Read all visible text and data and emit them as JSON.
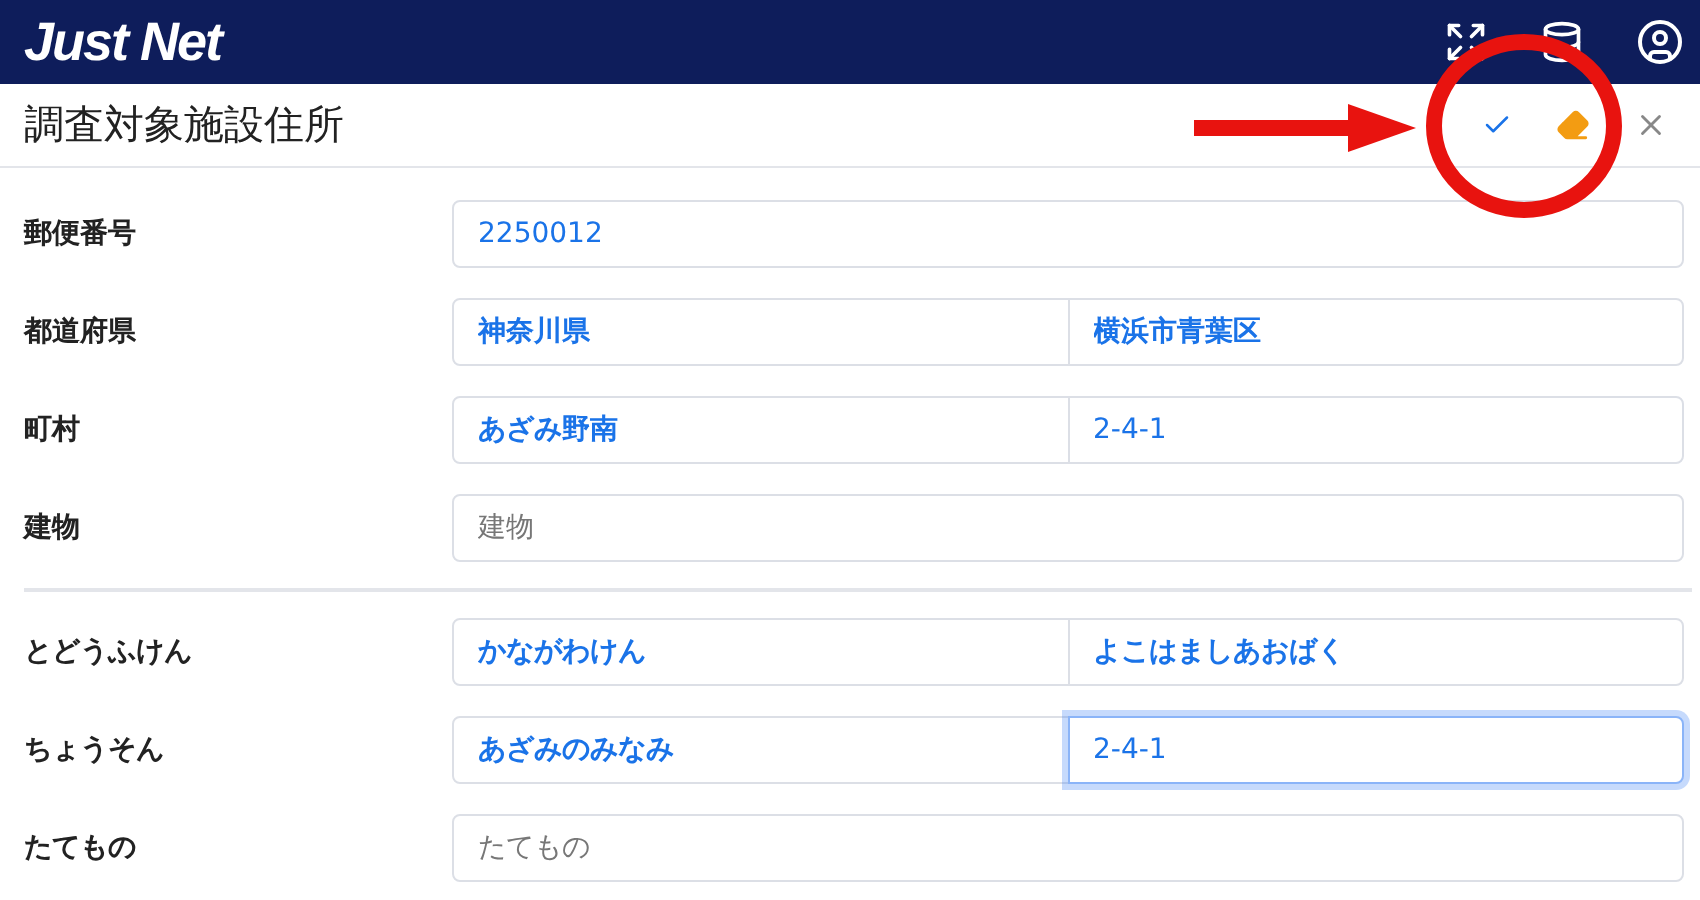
{
  "header": {
    "logo": "Just Net"
  },
  "panel": {
    "title": "調査対象施設住所"
  },
  "sections": [
    {
      "rows": [
        {
          "label": "郵便番号",
          "fields": [
            {
              "kind": "text",
              "value": "2250012",
              "focused": false
            }
          ]
        },
        {
          "label": "都道府県",
          "fields": [
            {
              "kind": "lookup",
              "value": "神奈川県",
              "focused": false
            },
            {
              "kind": "lookup",
              "value": "横浜市青葉区",
              "focused": false
            }
          ]
        },
        {
          "label": "町村",
          "fields": [
            {
              "kind": "lookup",
              "value": "あざみ野南",
              "focused": false
            },
            {
              "kind": "text",
              "value": "2-4-1",
              "focused": false
            }
          ]
        },
        {
          "label": "建物",
          "fields": [
            {
              "kind": "text",
              "placeholder": "建物",
              "focused": false
            }
          ]
        }
      ]
    },
    {
      "rows": [
        {
          "label": "とどうふけん",
          "fields": [
            {
              "kind": "lookup",
              "value": "かながわけん",
              "focused": false
            },
            {
              "kind": "lookup",
              "value": "よこはましあおばく",
              "focused": false
            }
          ]
        },
        {
          "label": "ちょうそん",
          "fields": [
            {
              "kind": "lookup",
              "value": "あざみのみなみ",
              "focused": false
            },
            {
              "kind": "text",
              "value": "2-4-1",
              "focused": true
            }
          ]
        },
        {
          "label": "たてもの",
          "fields": [
            {
              "kind": "text",
              "placeholder": "たてもの",
              "focused": false
            }
          ]
        }
      ]
    }
  ]
}
